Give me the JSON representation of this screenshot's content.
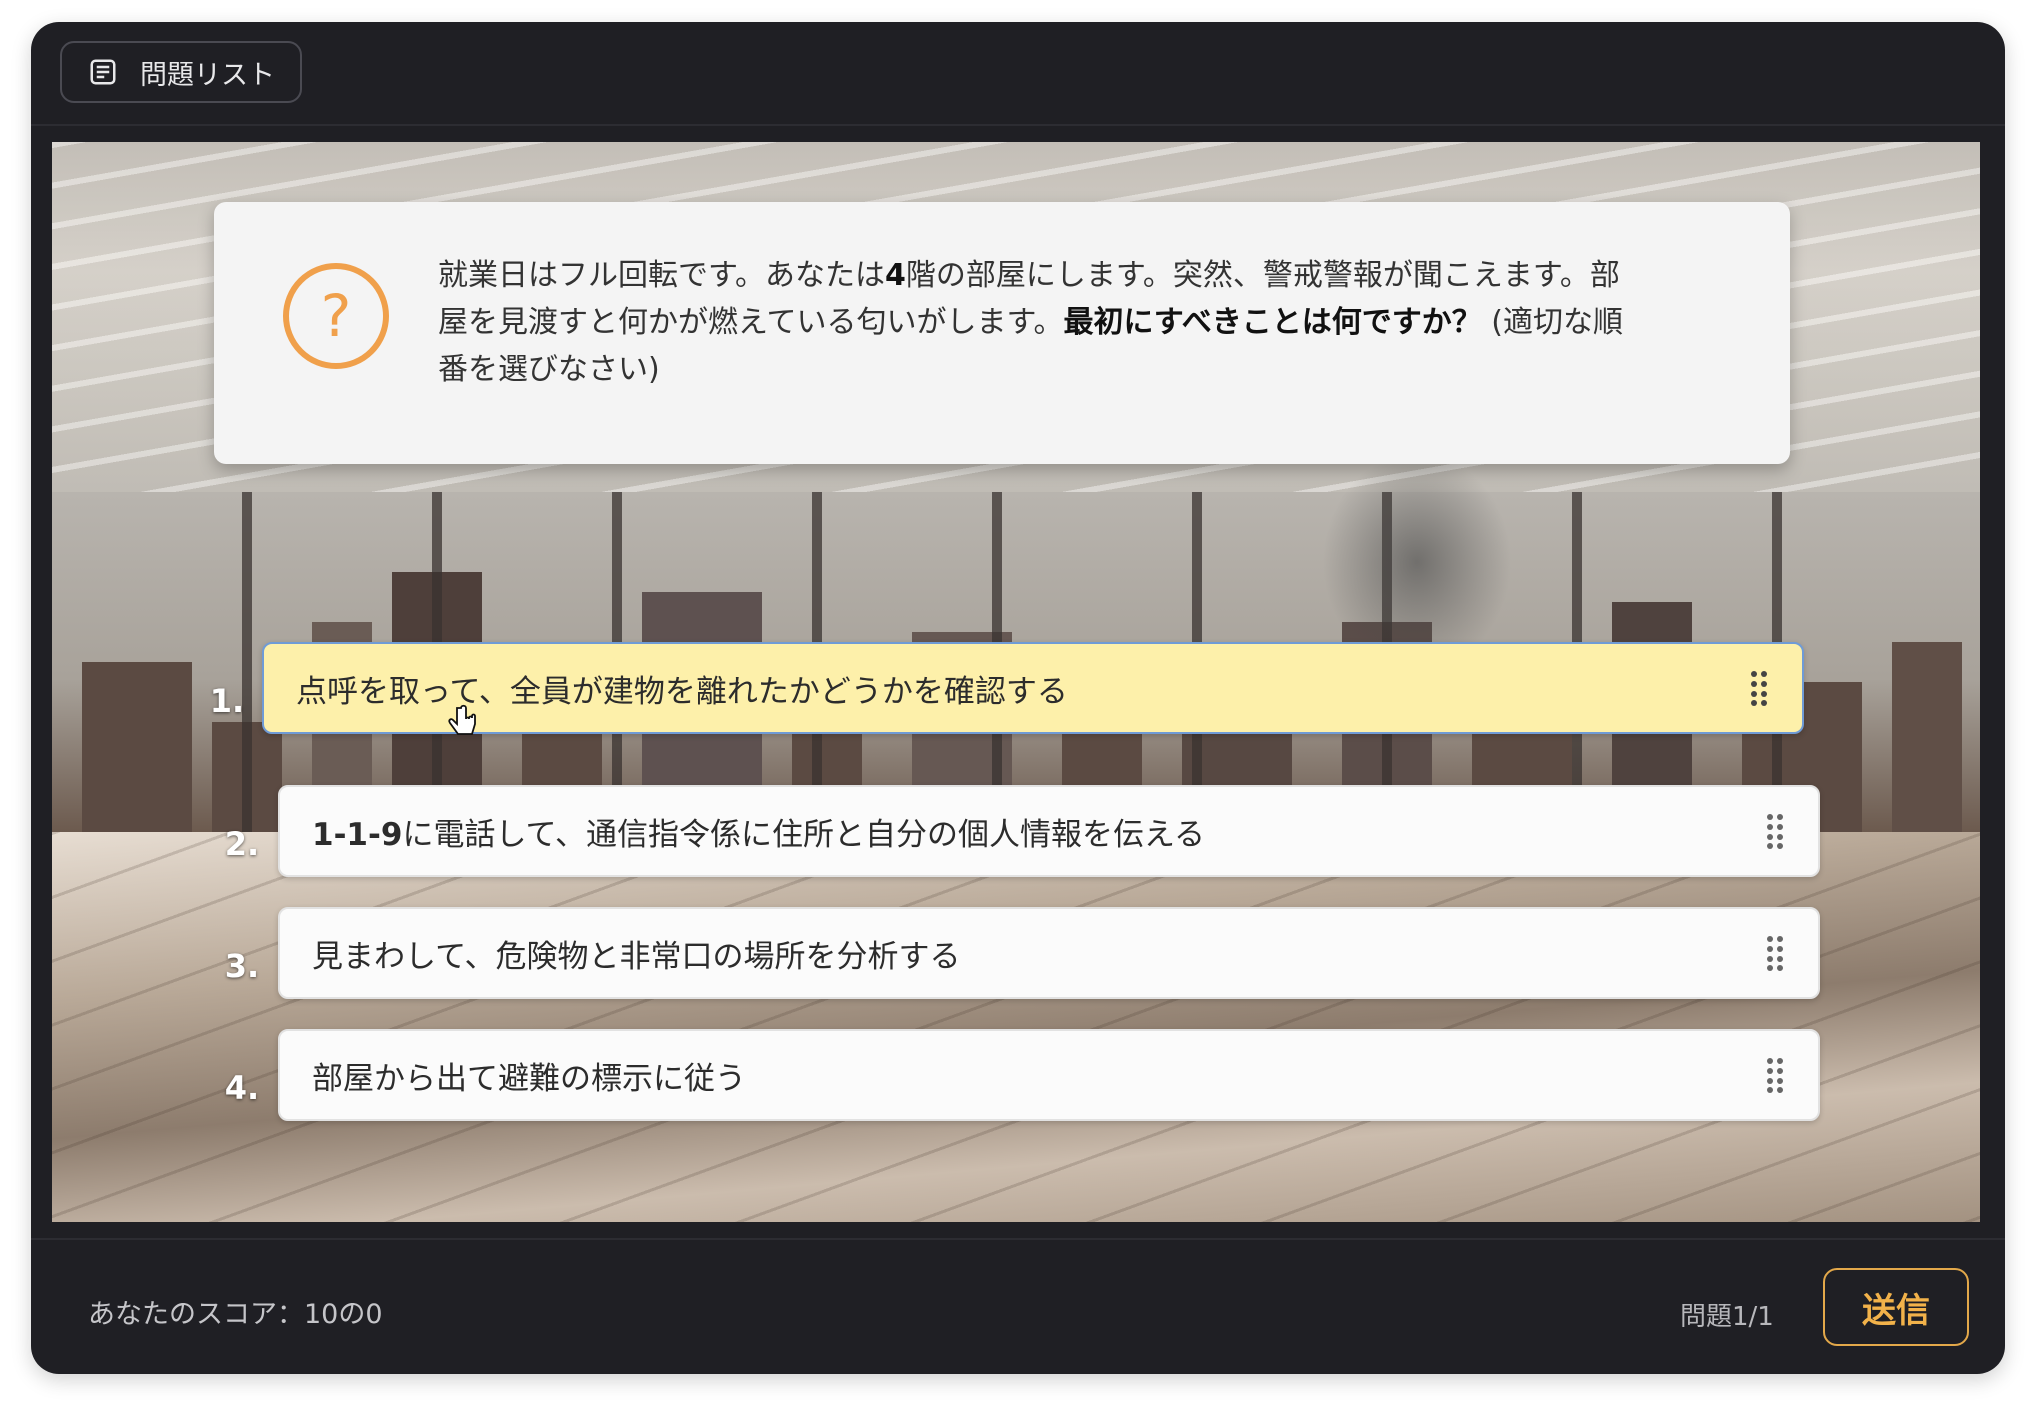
{
  "toolbar": {
    "question_list_label": "問題リスト",
    "question_list_icon": "list-document-icon"
  },
  "question": {
    "icon": "question-circle-icon",
    "accent": "#f0a04b",
    "text_part1": "就業日はフル回転です。あなたは",
    "text_bold_floor": "4",
    "text_part2": "階の部屋にします。突然、警戒警報が聞こえます。部屋を見渡すと何かが燃えている匂いがします。",
    "text_bold_question": "最初にすべきことは何ですか？",
    "text_part3": "(適切な順番を選びなさい)"
  },
  "answers": [
    {
      "number": "1.",
      "label": "点呼を取って、全員が建物を離れたかどうかを確認する",
      "selected": true
    },
    {
      "number": "2.",
      "label_bold": "1-1-9",
      "label": "に電話して、通信指令係に住所と自分の個人情報を伝える",
      "selected": false
    },
    {
      "number": "3.",
      "label": "見まわして、危険物と非常口の場所を分析する",
      "selected": false
    },
    {
      "number": "4.",
      "label": "部屋から出て避難の標示に従う",
      "selected": false
    }
  ],
  "footer": {
    "score_text": "あなたのスコア：10の0",
    "question_count": "問題1/1",
    "submit_label": "送信",
    "submit_color": "#f2b24a"
  }
}
